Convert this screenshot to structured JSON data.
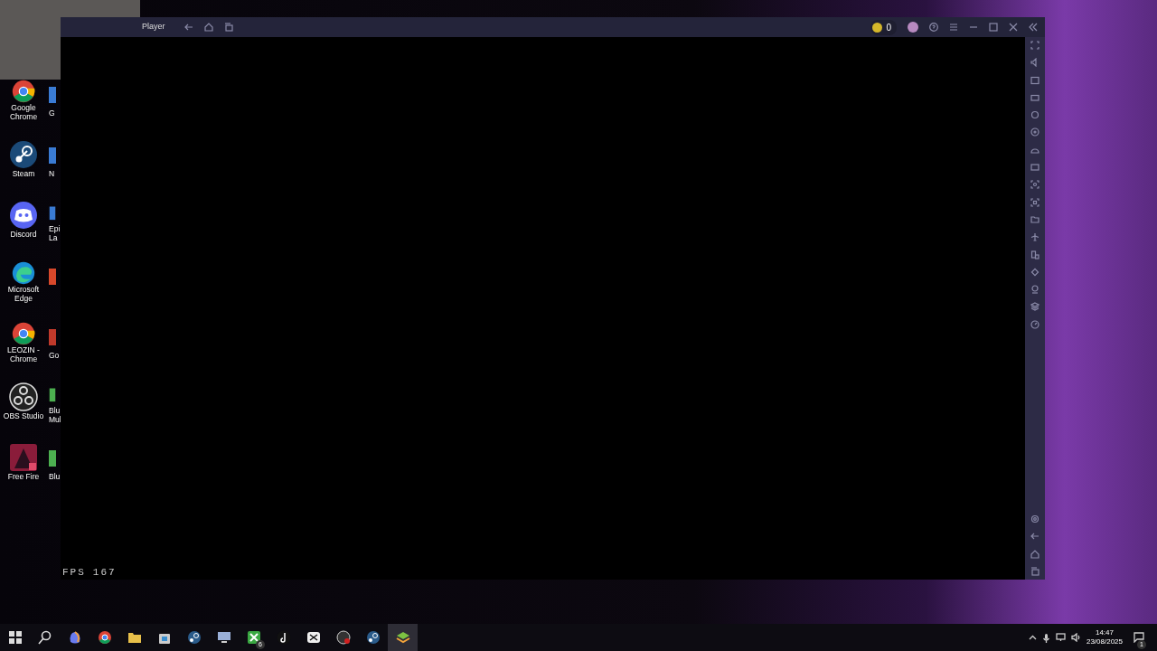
{
  "window": {
    "title": "Player",
    "coins": "0",
    "fps_label": "FPS",
    "fps_value": "167"
  },
  "desktop_icons": [
    {
      "label": "Google Chrome",
      "kind": "chrome"
    },
    {
      "label": "Steam",
      "kind": "steam"
    },
    {
      "label": "Discord",
      "kind": "discord"
    },
    {
      "label": "Microsoft Edge",
      "kind": "edge"
    },
    {
      "label": "LEOZIN - Chrome",
      "kind": "chrome"
    },
    {
      "label": "OBS Studio",
      "kind": "obs"
    },
    {
      "label": "Free Fire",
      "kind": "game"
    }
  ],
  "desktop_icons_partial": [
    {
      "label": "G",
      "color": "#3a7bd5"
    },
    {
      "label": "N",
      "color": "#3a7bd5"
    },
    {
      "label": "Epi La",
      "color": "#3a7bd5"
    },
    {
      "color": "#d8482b"
    },
    {
      "label": "Go",
      "color": "#c0392b"
    },
    {
      "label": "Blu Mul",
      "color": "#4caf50"
    },
    {
      "label": "Blu",
      "color": "#4caf50"
    }
  ],
  "taskbar": {
    "apps": [
      {
        "kind": "start",
        "selected": false
      },
      {
        "kind": "search",
        "selected": false
      },
      {
        "kind": "copilot",
        "selected": false
      },
      {
        "kind": "chrome",
        "selected": false
      },
      {
        "kind": "folder",
        "selected": false
      },
      {
        "kind": "store",
        "selected": false
      },
      {
        "kind": "steam",
        "selected": false
      },
      {
        "kind": "monitor",
        "selected": false
      },
      {
        "kind": "xbox",
        "selected": false,
        "badge": "6"
      },
      {
        "kind": "tiktok",
        "selected": false
      },
      {
        "kind": "capcut",
        "selected": false
      },
      {
        "kind": "obs",
        "selected": false
      },
      {
        "kind": "steam",
        "selected": false
      },
      {
        "kind": "layers",
        "selected": true
      }
    ],
    "time": "14:47",
    "date": "23/08/2025",
    "notifications": "1"
  }
}
